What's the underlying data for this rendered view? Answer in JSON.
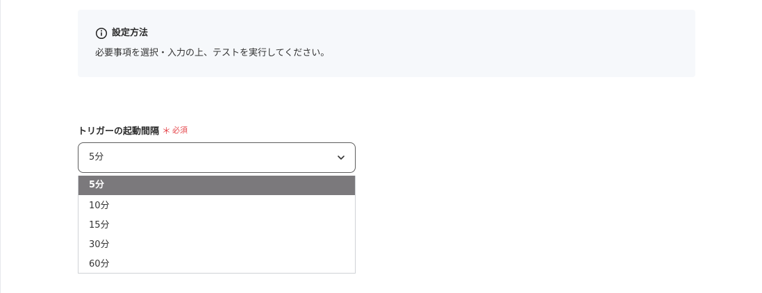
{
  "info": {
    "title": "設定方法",
    "text": "必要事項を選択・入力の上、テストを実行してください。"
  },
  "field": {
    "label": "トリガーの起動間隔",
    "required_mark": "＊",
    "required_text": "必須",
    "selected_value": "5分",
    "options": [
      "5分",
      "10分",
      "15分",
      "30分",
      "60分"
    ]
  },
  "colors": {
    "required": "#e5484d",
    "selected_option_bg": "#7b797c",
    "info_bg": "#f6f8fb"
  }
}
